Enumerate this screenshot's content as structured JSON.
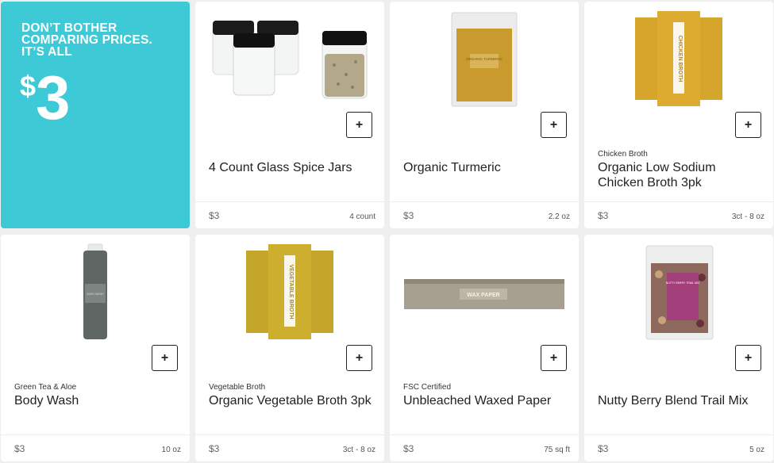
{
  "promo": {
    "headline_line1": "DON’T BOTHER",
    "headline_line2": "COMPARING PRICES.",
    "headline_line3": "IT’S ALL",
    "price_symbol": "$",
    "price_value": "3",
    "background_color": "#3ec9d6"
  },
  "add_label": "+",
  "products": [
    {
      "subtitle": "",
      "name": "4 Count Glass Spice Jars",
      "price": "$3",
      "size": "4 count",
      "image": "spice-jars-image"
    },
    {
      "subtitle": "",
      "name": "Organic Turmeric",
      "price": "$3",
      "size": "2.2 oz",
      "image": "turmeric-pouch-image",
      "package_text": "ORGANIC TURMERIC"
    },
    {
      "subtitle": "Chicken Broth",
      "name": "Organic Low Sodium Chicken Broth 3pk",
      "price": "$3",
      "size": "3ct - 8 oz",
      "image": "chicken-broth-cartons-image",
      "package_text": "CHICKEN BROTH"
    },
    {
      "subtitle": "Green Tea & Aloe",
      "name": "Body Wash",
      "price": "$3",
      "size": "10 oz",
      "image": "body-wash-bottle-image",
      "package_text": "BODY WASH"
    },
    {
      "subtitle": "Vegetable Broth",
      "name": "Organic Vegetable Broth 3pk",
      "price": "$3",
      "size": "3ct - 8 oz",
      "image": "vegetable-broth-cartons-image",
      "package_text": "VEGETABLE BROTH"
    },
    {
      "subtitle": "FSC Certified",
      "name": "Unbleached Waxed Paper",
      "price": "$3",
      "size": "75 sq ft",
      "image": "wax-paper-box-image",
      "package_text": "WAX PAPER"
    },
    {
      "subtitle": "",
      "name": "Nutty Berry Blend Trail Mix",
      "price": "$3",
      "size": "5 oz",
      "image": "trail-mix-bag-image",
      "package_text": "NUTTY BERRY TRAIL MIX"
    }
  ]
}
